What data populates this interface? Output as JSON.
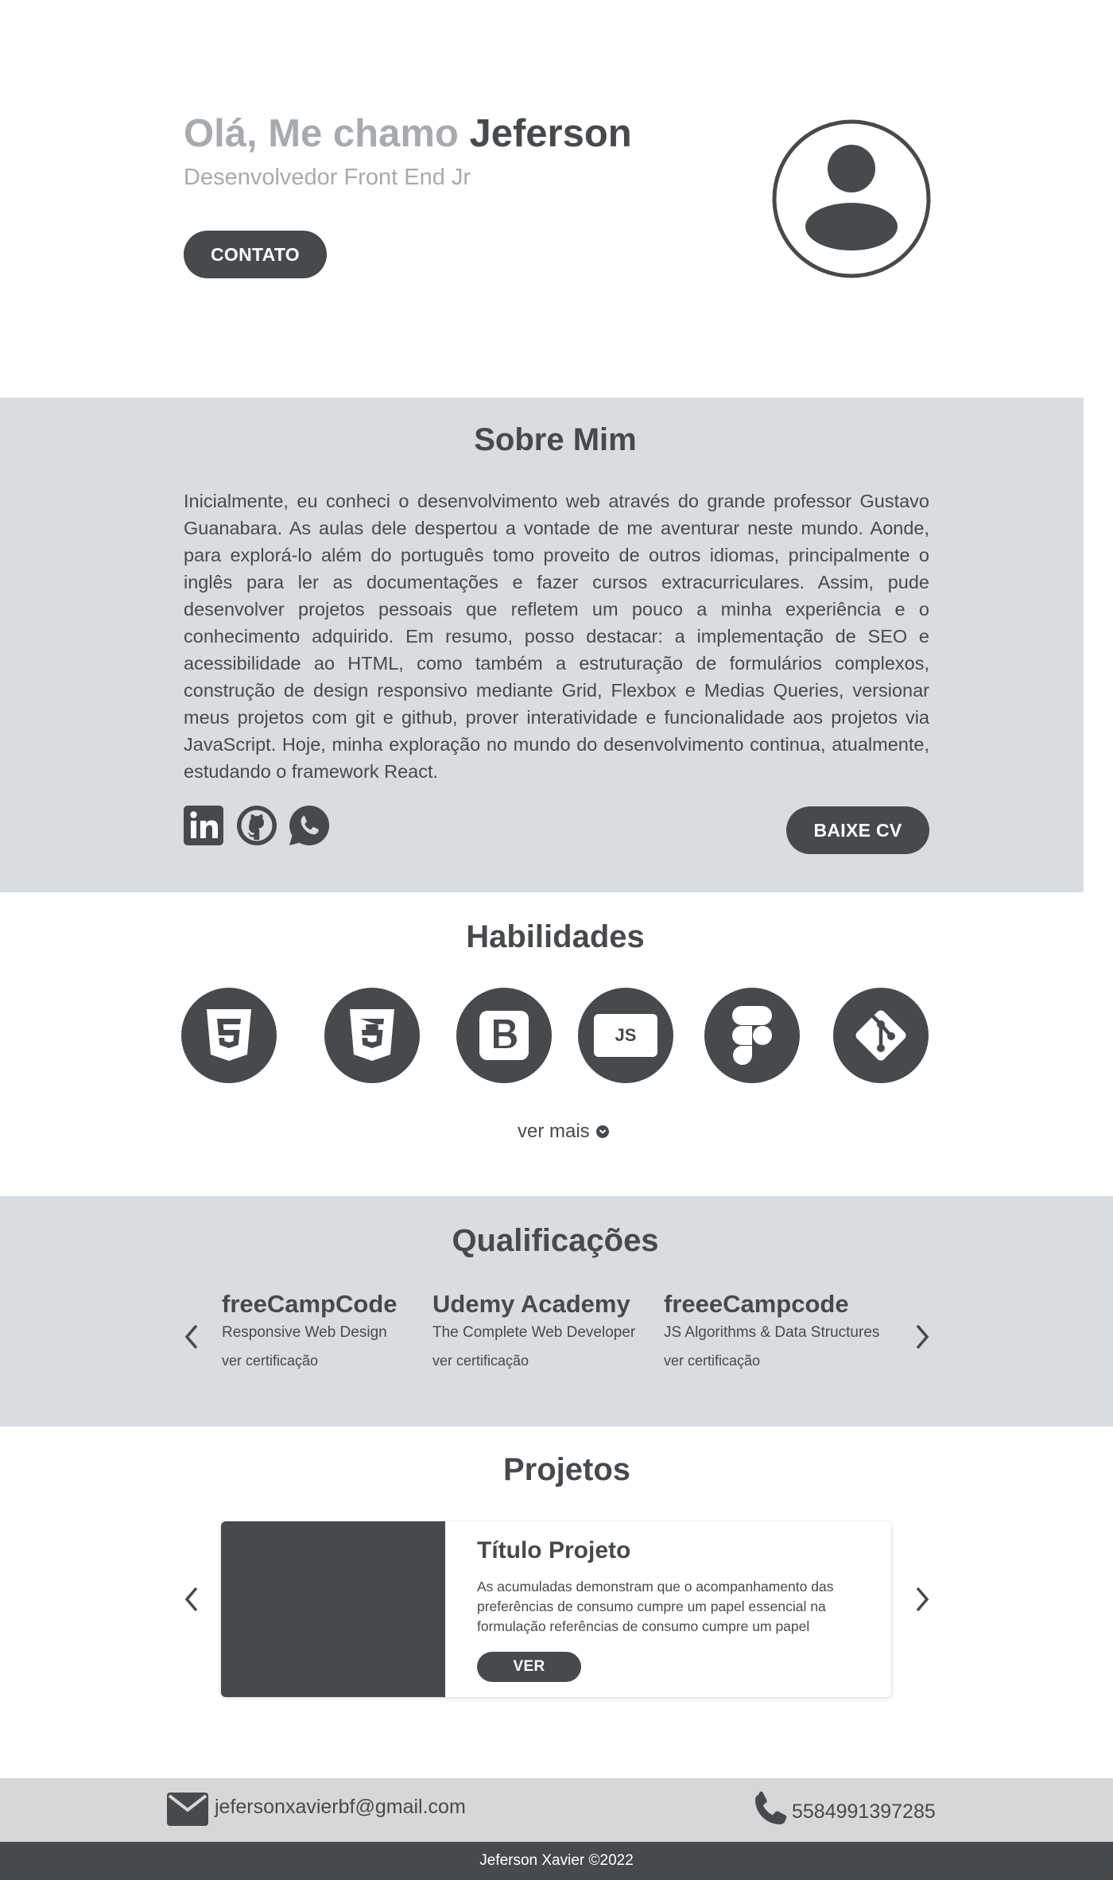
{
  "hero": {
    "greeting": "Olá, Me chamo ",
    "name": "Jeferson",
    "subtitle": "Desenvolvedor Front End Jr",
    "contact_button": "CONTATO",
    "avatar_icon": "user-avatar-icon"
  },
  "about": {
    "title": "Sobre Mim",
    "text": "Inicialmente, eu conheci o desenvolvimento web através do grande professor Gustavo Guanabara. As aulas dele despertou a vontade de me aventurar neste mundo. Aonde, para explorá-lo além do português tomo proveito de outros idiomas, principalmente o inglês para ler as documentações e fazer cursos extracurriculares. Assim, pude desenvolver projetos pessoais que refletem um pouco a minha experiência e o conhecimento adquirido. Em resumo, posso destacar: a implementação de SEO e acessibilidade ao HTML, como também a estruturação de formulários complexos, construção de design responsivo mediante Grid, Flexbox e Medias Queries, versionar meus projetos com git e github, prover interatividade e funcionalidade aos projetos via JavaScript. Hoje, minha exploração no mundo do desenvolvimento continua, atualmente, estudando o framework React.",
    "social_icons": [
      "linkedin-icon",
      "github-icon",
      "whatsapp-icon"
    ],
    "cv_button": "BAIXE CV"
  },
  "skills": {
    "title": "Habilidades",
    "icons": [
      "html5-icon",
      "css3-icon",
      "bootstrap-icon",
      "javascript-icon",
      "figma-icon",
      "git-icon"
    ],
    "js_label": "JS",
    "see_more": "ver mais"
  },
  "qualifications": {
    "title": "Qualificações",
    "items": [
      {
        "name": "freeCampCode",
        "course": "Responsive Web Design",
        "link": "ver certificação"
      },
      {
        "name": "Udemy Academy",
        "course": "The Complete Web Developer",
        "link": "ver certificação"
      },
      {
        "name": "freeeCampcode",
        "course": "JS Algorithms & Data Structures",
        "link": "ver certificação"
      }
    ]
  },
  "projects": {
    "title": "Projetos",
    "card": {
      "title": "Título Projeto",
      "description": "As  acumuladas demonstram que o acompanhamento das preferências de consumo cumpre um papel essencial na formulação referências de consumo cumpre um papel",
      "button": "VER"
    }
  },
  "footer": {
    "email": "jefersonxavierbf@gmail.com",
    "phone": "5584991397285",
    "copyright": "Jeferson Xavier ©2022"
  },
  "colors": {
    "dark": "#474a4d",
    "muted_text": "#a7aaae",
    "section_bg": "#d8dde1",
    "contact_bg": "#d7d7d7"
  }
}
